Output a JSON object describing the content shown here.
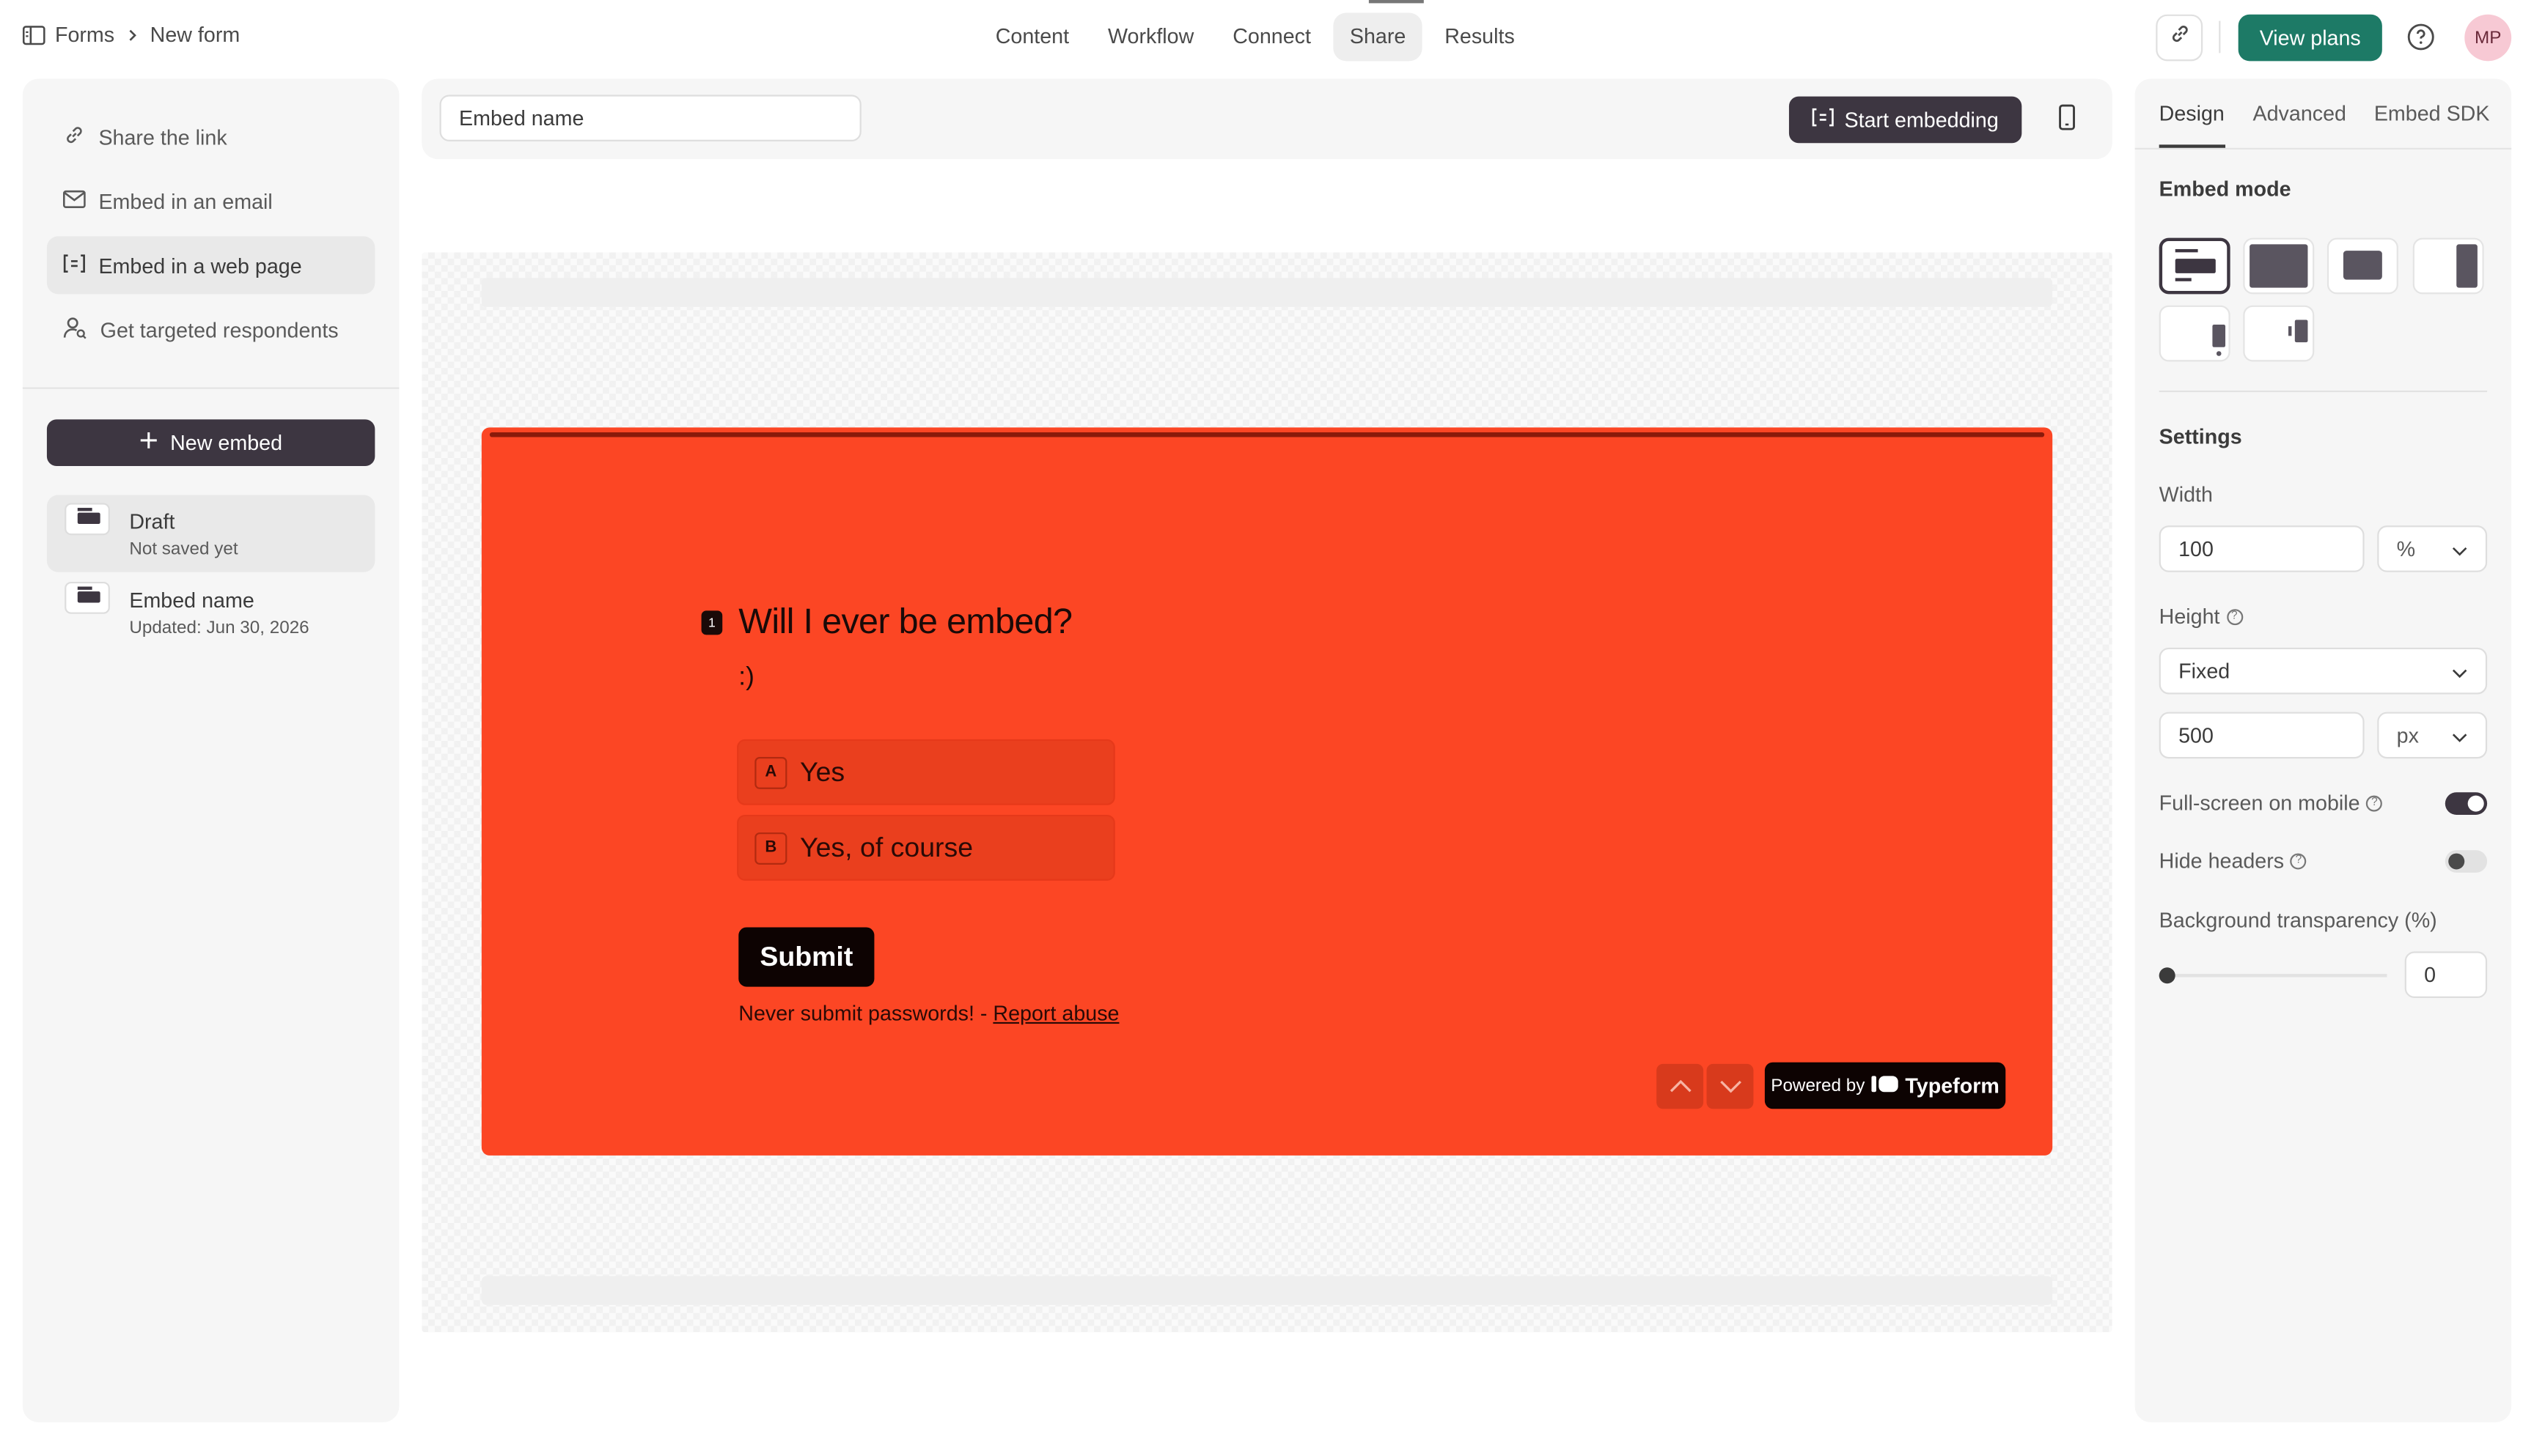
{
  "breadcrumb": {
    "root": "Forms",
    "current": "New form"
  },
  "nav": {
    "tabs": [
      {
        "label": "Content"
      },
      {
        "label": "Workflow"
      },
      {
        "label": "Connect"
      },
      {
        "label": "Share",
        "active": true
      },
      {
        "label": "Results"
      }
    ]
  },
  "header": {
    "view_plans": "View plans",
    "avatar_initials": "MP"
  },
  "share_menu": {
    "items": [
      {
        "label": "Share the link",
        "icon": "link-icon"
      },
      {
        "label": "Embed in an email",
        "icon": "mail-icon"
      },
      {
        "label": "Embed in a web page",
        "icon": "embed-code-icon",
        "active": true
      },
      {
        "label": "Get targeted respondents",
        "icon": "user-search-icon"
      }
    ]
  },
  "embeds": {
    "new_label": "New embed",
    "list": [
      {
        "title": "Draft",
        "subtitle": "Not saved yet",
        "active": true
      },
      {
        "title": "Embed name",
        "subtitle": "Updated: Jun 30, 2026"
      }
    ]
  },
  "embed_bar": {
    "name_value": "Embed name",
    "start_label": "Start embedding"
  },
  "form_preview": {
    "question_number": "1",
    "question": "Will I ever be embed?",
    "description": ":)",
    "choices": [
      {
        "key": "A",
        "label": "Yes"
      },
      {
        "key": "B",
        "label": "Yes, of course"
      }
    ],
    "submit_label": "Submit",
    "warning": "Never submit passwords! - ",
    "report_link": "Report abuse",
    "powered_by": "Powered by",
    "brand": "Typeform",
    "background_color": "#fc4624"
  },
  "settings_panel": {
    "tabs": [
      {
        "label": "Design",
        "active": true
      },
      {
        "label": "Advanced"
      },
      {
        "label": "Embed SDK"
      }
    ],
    "embed_mode_title": "Embed mode",
    "settings_title": "Settings",
    "width_label": "Width",
    "width_value": "100",
    "width_unit": "%",
    "height_label": "Height",
    "height_mode": "Fixed",
    "height_value": "500",
    "height_unit": "px",
    "fullscreen_label": "Full-screen on mobile",
    "fullscreen_on": true,
    "hide_headers_label": "Hide headers",
    "hide_headers_on": false,
    "transparency_label": "Background transparency (%)",
    "transparency_value": "0"
  },
  "colors": {
    "accent": "#1d7a66",
    "dark": "#3d3641",
    "form_bg": "#fc4624"
  }
}
